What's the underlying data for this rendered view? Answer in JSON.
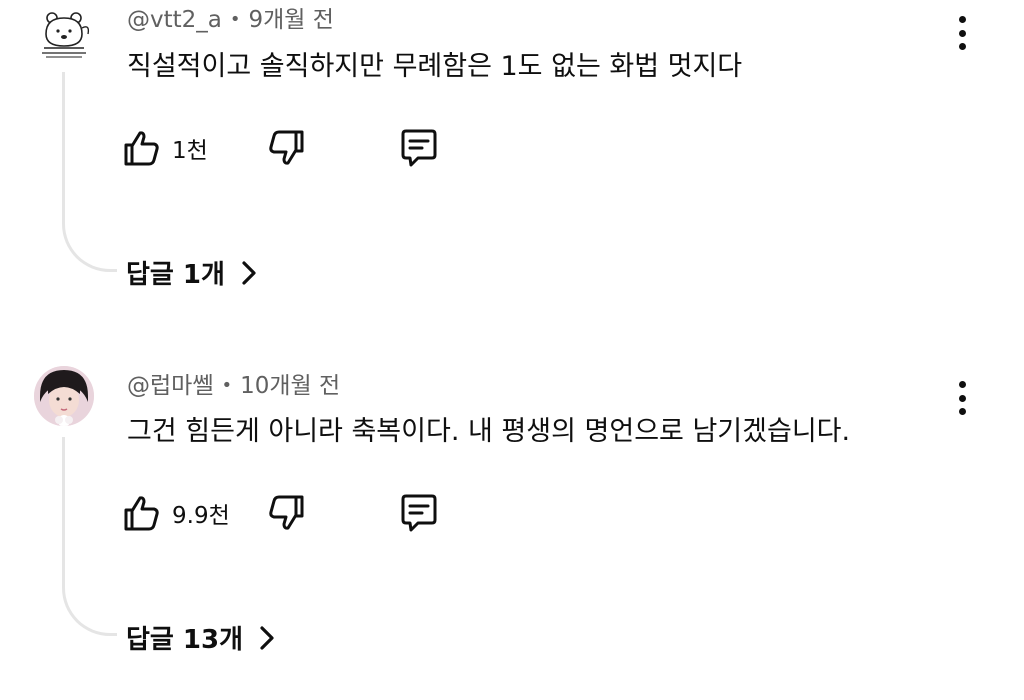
{
  "comments": [
    {
      "author": "@vtt2_a",
      "time": "9개월 전",
      "text": "직설적이고 솔직하지만 무례함은 1도 없는 화법 멋지다",
      "likes": "1천",
      "replies_label": "답글 1개",
      "avatar_icon": "bear-doodle-avatar"
    },
    {
      "author": "@럽마쎌",
      "time": "10개월 전",
      "text": "그건 힘든게 아니라 축복이다. 내 평생의 명언으로 남기겠습니다.",
      "likes": "9.9천",
      "replies_label": "답글 13개",
      "avatar_icon": "profile-photo-avatar"
    }
  ],
  "meta_separator": "•",
  "icons": {
    "like": "thumbs-up-icon",
    "dislike": "thumbs-down-icon",
    "reply": "reply-bubble-icon",
    "more": "more-options-icon",
    "chevron": "chevron-right-icon"
  },
  "colors": {
    "text": "#0f0f0f",
    "meta": "#606060",
    "thread_line": "#e5e5e5"
  }
}
